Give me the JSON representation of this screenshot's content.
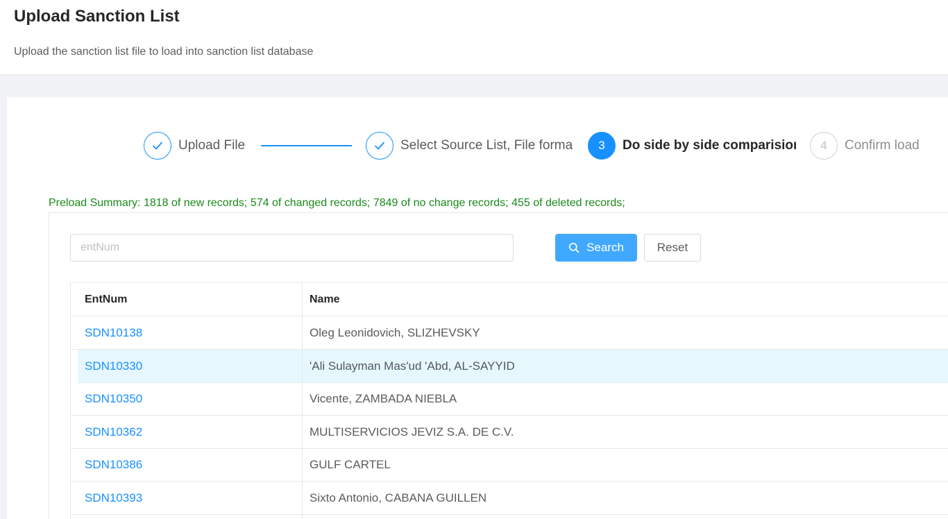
{
  "header": {
    "title": "Upload Sanction List",
    "description": "Upload the sanction list file to load into sanction list database"
  },
  "steps": [
    {
      "title": "Upload File",
      "status": "done",
      "icon": "check-icon"
    },
    {
      "title": "Select Source List, File forma",
      "status": "done",
      "icon": "check-icon"
    },
    {
      "number": "3",
      "title": "Do side by side comparisior",
      "status": "active"
    },
    {
      "number": "4",
      "title": "Confirm load",
      "status": "wait"
    }
  ],
  "summary": "Preload Summary: 1818 of new records; 574 of changed records; 7849 of no change records; 455 of deleted records;",
  "search": {
    "placeholder": "entNum",
    "value": "",
    "search_label": "Search",
    "reset_label": "Reset"
  },
  "table": {
    "columns": [
      "EntNum",
      "Name"
    ],
    "rows": [
      {
        "id": "SDN10138",
        "name": "Oleg Leonidovich, SLIZHEVSKY"
      },
      {
        "id": "SDN10330",
        "name": "'Ali Sulayman Mas'ud 'Abd, AL-SAYYID"
      },
      {
        "id": "SDN10350",
        "name": "Vicente, ZAMBADA NIEBLA"
      },
      {
        "id": "SDN10362",
        "name": "MULTISERVICIOS JEVIZ S.A. DE C.V."
      },
      {
        "id": "SDN10386",
        "name": "GULF CARTEL"
      },
      {
        "id": "SDN10393",
        "name": "Sixto Antonio, CABANA GUILLEN"
      }
    ]
  },
  "colors": {
    "primary": "#1890ff",
    "summary_text": "#1a8a1a",
    "row_highlight": "#e6f7ff"
  }
}
